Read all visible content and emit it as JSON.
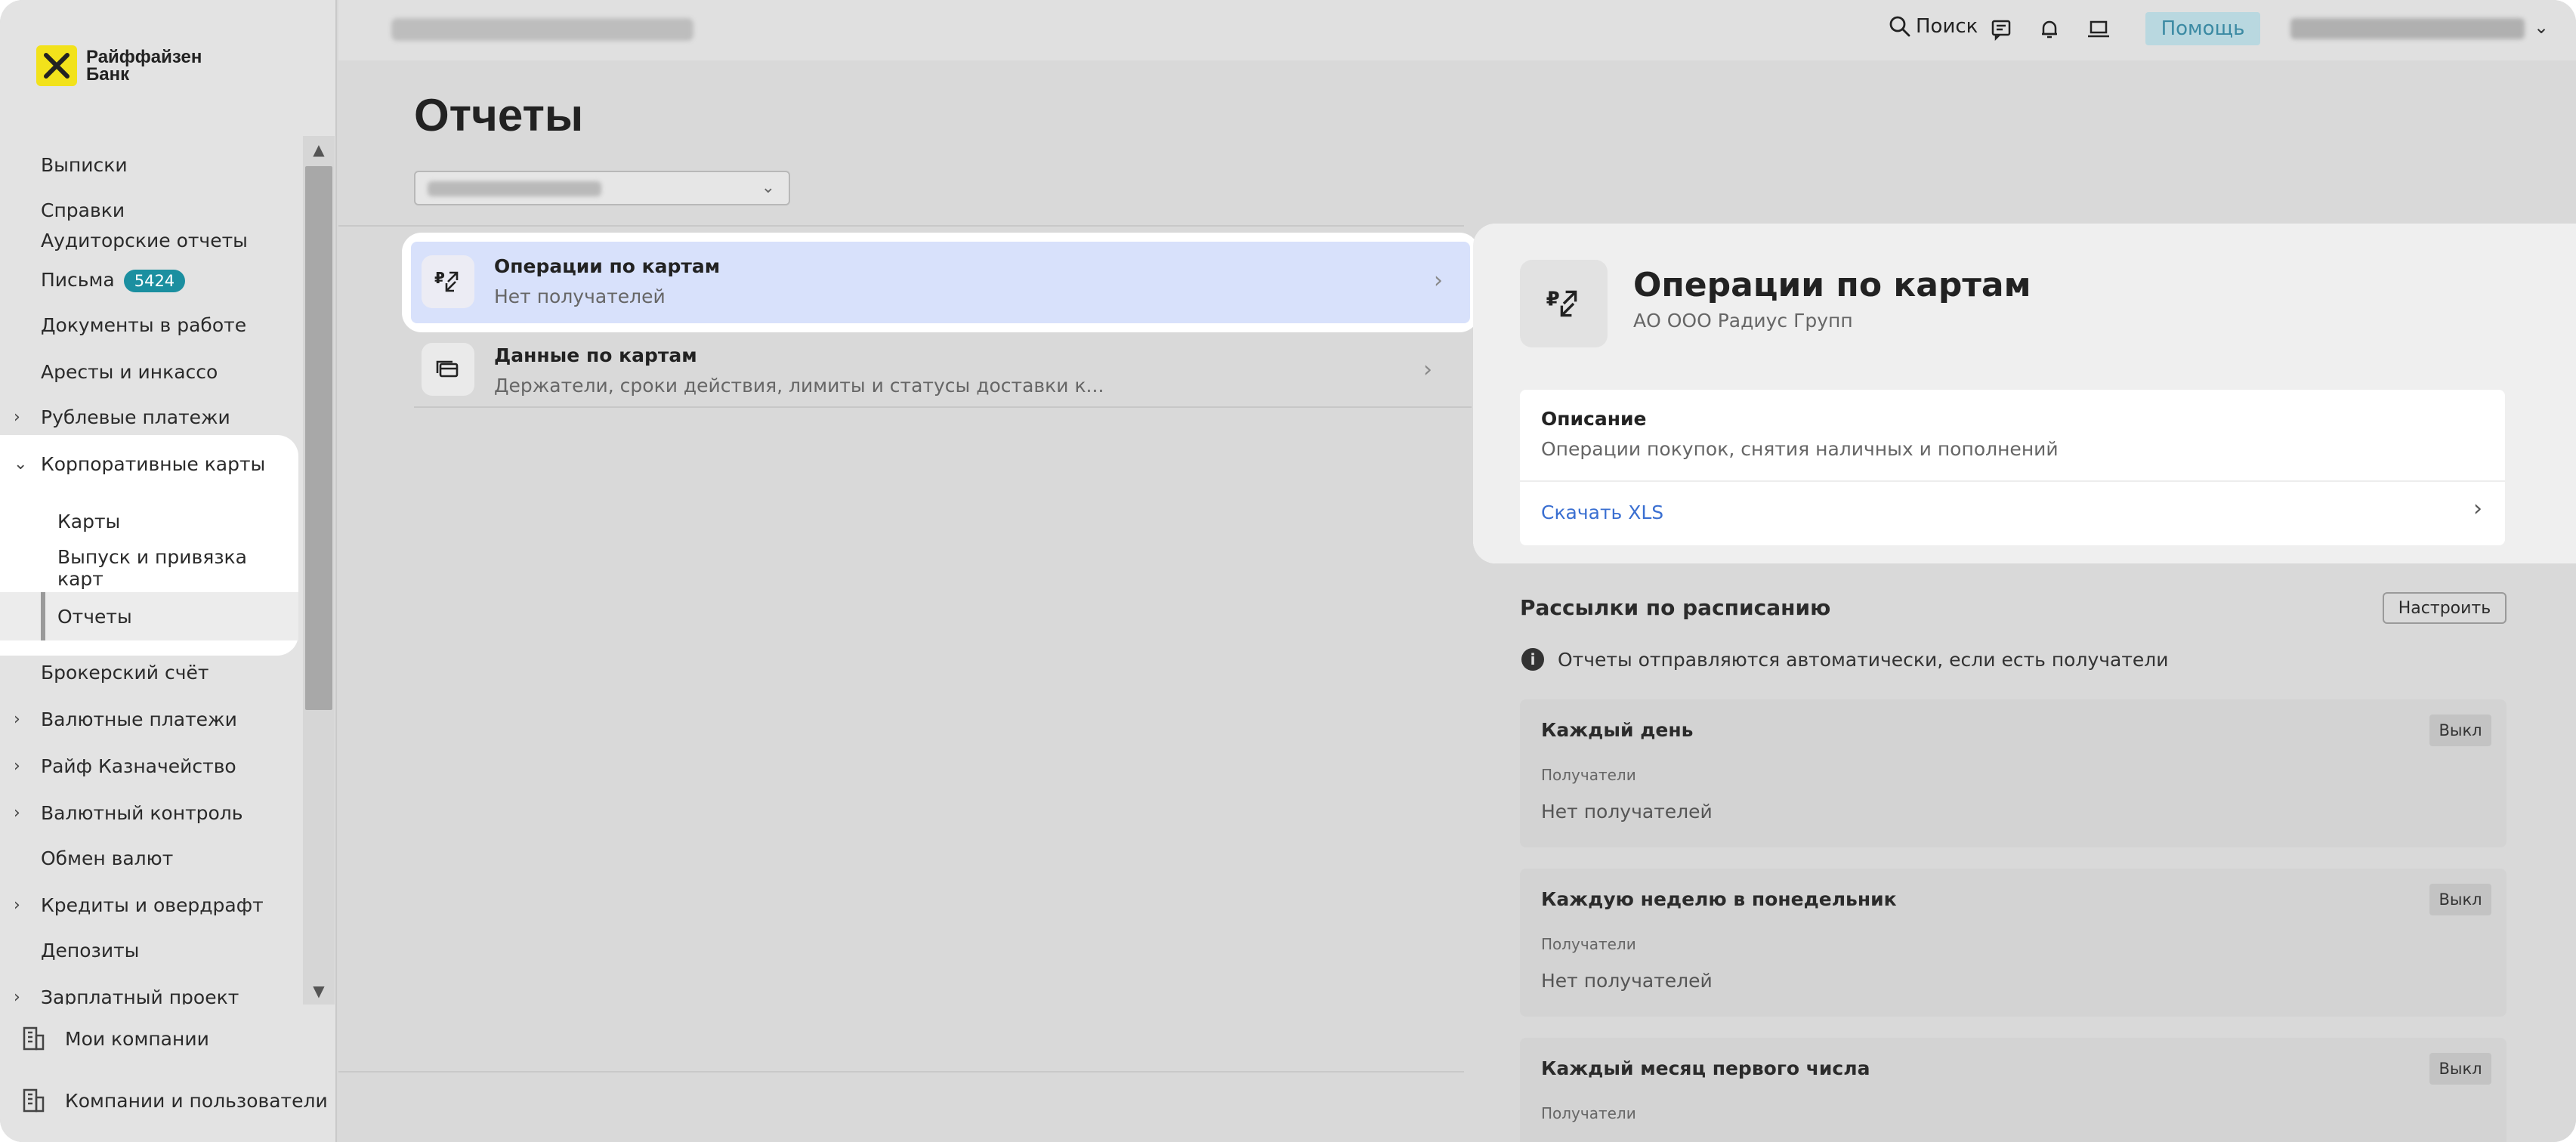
{
  "brand": {
    "name_line1": "Райффайзен",
    "name_line2": "Банк",
    "accent": "#f2e21b"
  },
  "topbar": {
    "search_label": "Поиск",
    "help_label": "Помощь",
    "icons": [
      "search-icon",
      "chat-icon",
      "bell-icon",
      "laptop-icon",
      "chevron-down-icon"
    ]
  },
  "sidebar": {
    "items": [
      {
        "label": "Выписки"
      },
      {
        "label": "Справки"
      },
      {
        "label": "Аудиторские отчеты"
      },
      {
        "label": "Письма",
        "badge": "5424"
      },
      {
        "label": "Документы в работе"
      },
      {
        "label": "Аресты и инкассо"
      },
      {
        "label": "Рублевые платежи",
        "expandable": true
      },
      {
        "label": "Корпоративные карты",
        "expanded": true
      },
      {
        "label": "Карты"
      },
      {
        "label": "Выпуск и привязка карт"
      },
      {
        "label": "Отчеты",
        "active": true
      },
      {
        "label": "Брокерский счёт"
      },
      {
        "label": "Валютные платежи",
        "expandable": true
      },
      {
        "label": "Райф Казначейство",
        "expandable": true
      },
      {
        "label": "Валютный контроль",
        "expandable": true
      },
      {
        "label": "Обмен валют"
      },
      {
        "label": "Кредиты и овердрафт",
        "expandable": true
      },
      {
        "label": "Депозиты"
      },
      {
        "label": "Зарплатный проект",
        "expandable": true
      }
    ],
    "footer": [
      {
        "label": "Мои компании"
      },
      {
        "label": "Компании и пользователи"
      }
    ],
    "badge_color": "#1b8fa0"
  },
  "main": {
    "title": "Отчеты",
    "reports": [
      {
        "title": "Операции по картам",
        "subtitle": "Нет получателей",
        "selected": true
      },
      {
        "title": "Данные по картам",
        "subtitle": "Держатели, сроки действия, лимиты и статусы доставки к..."
      }
    ]
  },
  "details": {
    "title": "Операции по картам",
    "subtitle": "АО ООО Радиус Групп",
    "description_label": "Описание",
    "description_text": "Операции покупок, снятия наличных и пополнений",
    "download_label": "Скачать XLS",
    "link_color": "#3a6fd1"
  },
  "schedule": {
    "title": "Рассылки по расписанию",
    "config_button": "Настроить",
    "info": "Отчеты отправляются автоматически, если есть получатели",
    "cards": [
      {
        "title": "Каждый день",
        "toggle": "Выкл",
        "recipients_label": "Получатели",
        "recipients": "Нет получателей"
      },
      {
        "title": "Каждую неделю в понедельник",
        "toggle": "Выкл",
        "recipients_label": "Получатели",
        "recipients": "Нет получателей"
      },
      {
        "title": "Каждый месяц первого числа",
        "toggle": "Выкл",
        "recipients_label": "Получатели",
        "recipients": ""
      }
    ]
  }
}
